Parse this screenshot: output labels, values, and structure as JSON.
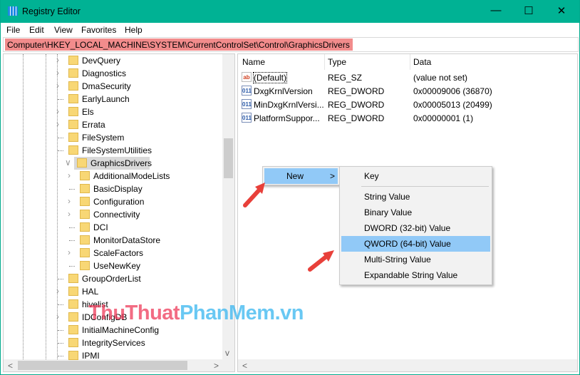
{
  "window": {
    "title": "Registry Editor",
    "minimize": "—",
    "maximize": "☐",
    "close": "✕"
  },
  "menu": [
    "File",
    "Edit",
    "View",
    "Favorites",
    "Help"
  ],
  "address": "Computer\\HKEY_LOCAL_MACHINE\\SYSTEM\\CurrentControlSet\\Control\\GraphicsDrivers",
  "tree": [
    {
      "label": "DevQuery",
      "level": 0,
      "exp": ">"
    },
    {
      "label": "Diagnostics",
      "level": 0,
      "exp": ">"
    },
    {
      "label": "DmaSecurity",
      "level": 0,
      "exp": ">"
    },
    {
      "label": "EarlyLaunch",
      "level": 0,
      "exp": ""
    },
    {
      "label": "Els",
      "level": 0,
      "exp": ">"
    },
    {
      "label": "Errata",
      "level": 0,
      "exp": ">"
    },
    {
      "label": "FileSystem",
      "level": 0,
      "exp": ""
    },
    {
      "label": "FileSystemUtilities",
      "level": 0,
      "exp": ""
    },
    {
      "label": "GraphicsDrivers",
      "level": 0,
      "exp": "v",
      "selected": true
    },
    {
      "label": "AdditionalModeLists",
      "level": 1,
      "exp": ">"
    },
    {
      "label": "BasicDisplay",
      "level": 1,
      "exp": ""
    },
    {
      "label": "Configuration",
      "level": 1,
      "exp": ">"
    },
    {
      "label": "Connectivity",
      "level": 1,
      "exp": ">"
    },
    {
      "label": "DCI",
      "level": 1,
      "exp": ""
    },
    {
      "label": "MonitorDataStore",
      "level": 1,
      "exp": ""
    },
    {
      "label": "ScaleFactors",
      "level": 1,
      "exp": ">"
    },
    {
      "label": "UseNewKey",
      "level": 1,
      "exp": ""
    },
    {
      "label": "GroupOrderList",
      "level": 0,
      "exp": ""
    },
    {
      "label": "HAL",
      "level": 0,
      "exp": ">"
    },
    {
      "label": "hivelist",
      "level": 0,
      "exp": ""
    },
    {
      "label": "IDConfigDB",
      "level": 0,
      "exp": ">"
    },
    {
      "label": "InitialMachineConfig",
      "level": 0,
      "exp": ""
    },
    {
      "label": "IntegrityServices",
      "level": 0,
      "exp": ""
    },
    {
      "label": "IPMI",
      "level": 0,
      "exp": ""
    }
  ],
  "columns": {
    "name": "Name",
    "type": "Type",
    "data": "Data"
  },
  "values": [
    {
      "name": "(Default)",
      "type": "REG_SZ",
      "data": "(value not set)",
      "icon": "ab"
    },
    {
      "name": "DxgKrnlVersion",
      "type": "REG_DWORD",
      "data": "0x00009006 (36870)",
      "icon": "011"
    },
    {
      "name": "MinDxgKrnlVersi...",
      "type": "REG_DWORD",
      "data": "0x00005013 (20499)",
      "icon": "011"
    },
    {
      "name": "PlatformSuppor...",
      "type": "REG_DWORD",
      "data": "0x00000001 (1)",
      "icon": "011"
    }
  ],
  "context": {
    "new": "New",
    "arrow": ">"
  },
  "submenu": [
    "Key",
    "String Value",
    "Binary Value",
    "DWORD (32-bit) Value",
    "QWORD (64-bit) Value",
    "Multi-String Value",
    "Expandable String Value"
  ],
  "watermark": {
    "a": "ThuThuat",
    "b": "PhanMem",
    "c": ".vn"
  },
  "scroll": {
    "left": "<",
    "right": ">",
    "down": "v"
  }
}
